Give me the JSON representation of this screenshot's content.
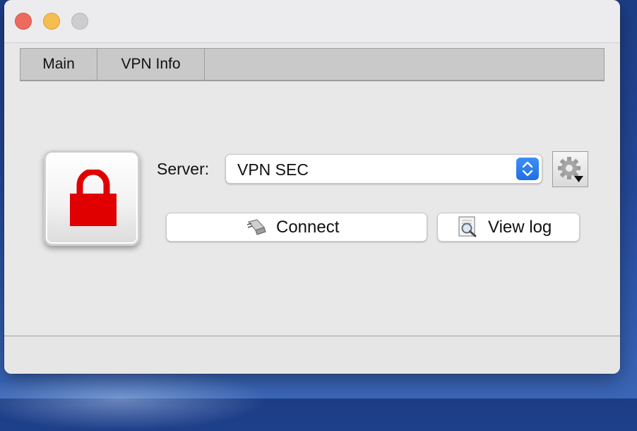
{
  "window": {
    "controls": [
      "close",
      "minimize",
      "zoom"
    ]
  },
  "tabs": [
    {
      "label": "Main",
      "selected": true
    },
    {
      "label": "VPN Info",
      "selected": false
    }
  ],
  "status": {
    "icon": "lock-closed-icon",
    "state_color": "#e00000"
  },
  "server": {
    "label": "Server:",
    "selected": "VPN SEC",
    "arrow_icon": "updown-chevron-icon",
    "settings_icon": "gear-dropdown-icon"
  },
  "buttons": {
    "connect_label": "Connect",
    "connect_icon": "plug-icon",
    "viewlog_label": "View log",
    "viewlog_icon": "log-magnifier-icon"
  },
  "colors": {
    "accent": "#2a7cf0",
    "close": "#ee6a5f",
    "minimize": "#f5be4f",
    "zoom": "#cdcdcf"
  }
}
